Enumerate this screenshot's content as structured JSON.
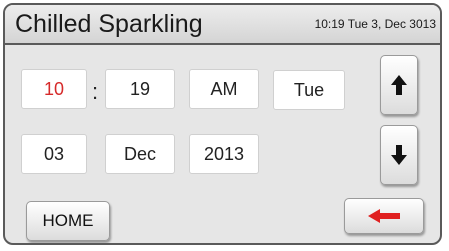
{
  "header": {
    "title": "Chilled Sparkling",
    "clock": "10:19 Tue 3, Dec 3013"
  },
  "time": {
    "hour": "10",
    "separator": ":",
    "minute": "19",
    "ampm": "AM",
    "weekday": "Tue"
  },
  "date": {
    "day": "03",
    "month": "Dec",
    "year": "2013"
  },
  "buttons": {
    "home_label": "HOME",
    "up_icon": "arrow-up-icon",
    "down_icon": "arrow-down-icon",
    "back_icon": "arrow-left-icon"
  },
  "colors": {
    "selected_text": "#d62a2a",
    "back_arrow": "#e02020"
  }
}
